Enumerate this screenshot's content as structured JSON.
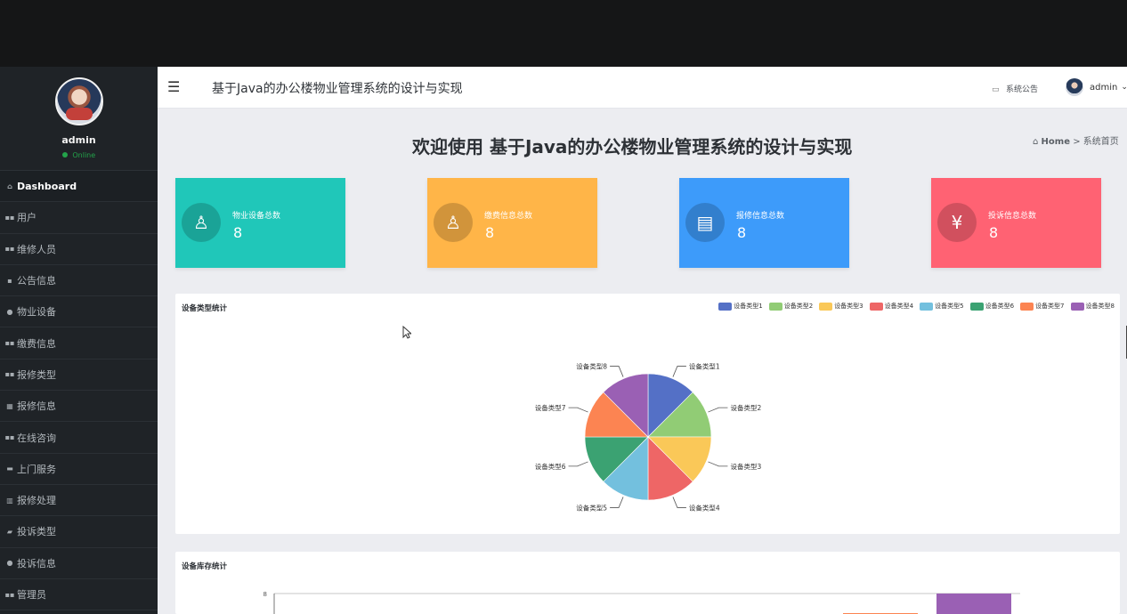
{
  "header": {
    "app_title": "基于Java的办公楼物业管理系统的设计与实现",
    "notice": "系统公告",
    "user": "admin"
  },
  "sidebar": {
    "user": "admin",
    "status": "Online",
    "items": [
      {
        "label": "Dashboard",
        "icon": "home-icon"
      },
      {
        "label": "用户",
        "icon": "grid-icon"
      },
      {
        "label": "维修人员",
        "icon": "grid-icon"
      },
      {
        "label": "公告信息",
        "icon": "document-icon"
      },
      {
        "label": "物业设备",
        "icon": "user-icon"
      },
      {
        "label": "缴费信息",
        "icon": "grid-icon"
      },
      {
        "label": "报修类型",
        "icon": "grid-icon"
      },
      {
        "label": "报修信息",
        "icon": "table-icon"
      },
      {
        "label": "在线咨询",
        "icon": "grid-icon"
      },
      {
        "label": "上门服务",
        "icon": "briefcase-icon"
      },
      {
        "label": "报修处理",
        "icon": "bar-chart-icon"
      },
      {
        "label": "投诉类型",
        "icon": "thumbs-icon"
      },
      {
        "label": "投诉信息",
        "icon": "user-icon"
      },
      {
        "label": "管理员",
        "icon": "grid-icon"
      }
    ]
  },
  "page": {
    "welcome": "欢迎使用 基于Java的办公楼物业管理系统的设计与实现",
    "breadcrumb_home": "Home",
    "breadcrumb_separator": ">",
    "breadcrumb_current": "系统首页"
  },
  "cards": [
    {
      "label": "物业设备总数",
      "value": "8",
      "color": "#20c7b9",
      "icon": "user-outline-icon"
    },
    {
      "label": "缴费信息总数",
      "value": "8",
      "color": "#ffb548",
      "icon": "user-outline-icon"
    },
    {
      "label": "报修信息总数",
      "value": "8",
      "color": "#3d9bfa",
      "icon": "document-icon"
    },
    {
      "label": "投诉信息总数",
      "value": "8",
      "color": "#ff6273",
      "icon": "yen-icon"
    }
  ],
  "chart_data": [
    {
      "type": "pie",
      "title": "设备类型统计",
      "legend": [
        "设备类型1",
        "设备类型2",
        "设备类型3",
        "设备类型4",
        "设备类型5",
        "设备类型6",
        "设备类型7",
        "设备类型8"
      ],
      "categories": [
        "设备类型1",
        "设备类型2",
        "设备类型3",
        "设备类型4",
        "设备类型5",
        "设备类型6",
        "设备类型7",
        "设备类型8"
      ],
      "values": [
        1,
        1,
        1,
        1,
        1,
        1,
        1,
        1
      ],
      "colors": [
        "#5470c6",
        "#91cc75",
        "#fac858",
        "#ee6666",
        "#73c0de",
        "#3ba272",
        "#fc8452",
        "#9a60b4"
      ]
    },
    {
      "type": "bar",
      "title": "设备库存统计",
      "y_tick_labels": [
        "8"
      ],
      "ylim": [
        0,
        8
      ],
      "visible_bar_colors": [
        "#fc8452",
        "#9a60b4"
      ]
    }
  ]
}
